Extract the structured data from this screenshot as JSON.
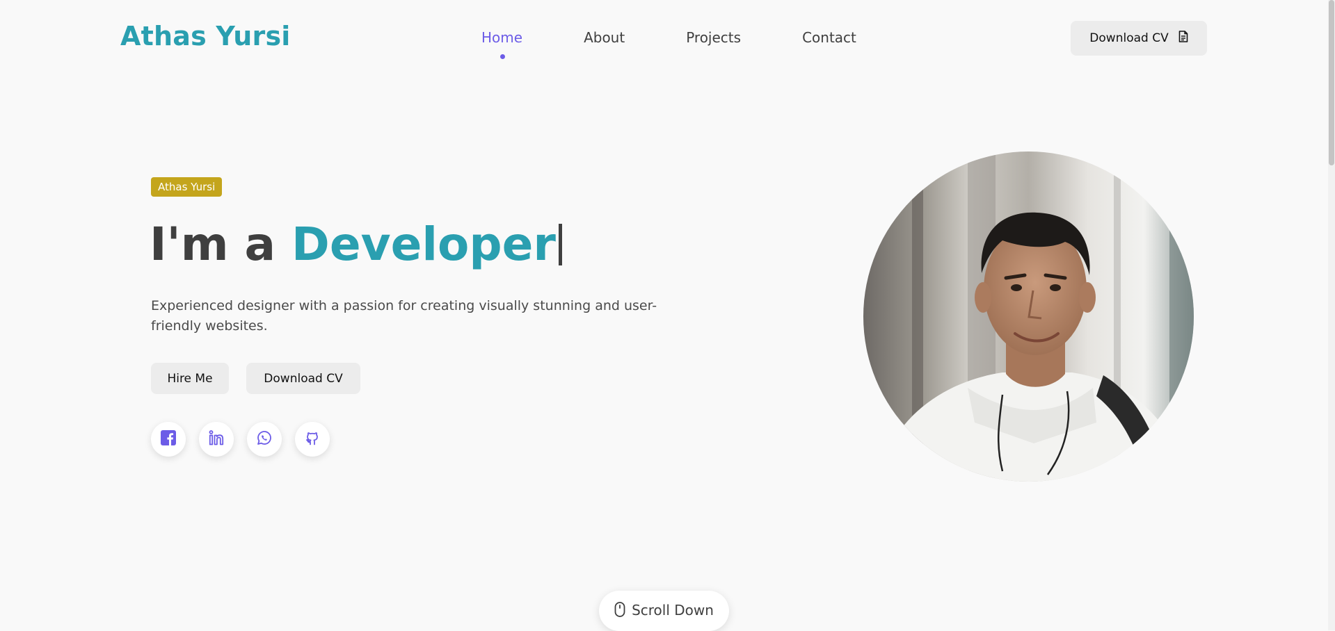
{
  "header": {
    "logo": "Athas Yursi",
    "nav": [
      {
        "label": "Home",
        "active": true
      },
      {
        "label": "About",
        "active": false
      },
      {
        "label": "Projects",
        "active": false
      },
      {
        "label": "Contact",
        "active": false
      }
    ],
    "download_cv_label": "Download CV",
    "download_icon": "file-text-icon"
  },
  "hero": {
    "badge": "Athas Yursi",
    "headline_prefix": "I'm a ",
    "headline_role": "Developer",
    "description": "Experienced designer with a passion for creating visually stunning and user-friendly websites.",
    "hire_label": "Hire Me",
    "download_cv_label": "Download CV",
    "socials": [
      {
        "name": "facebook-icon"
      },
      {
        "name": "linkedin-icon"
      },
      {
        "name": "whatsapp-icon"
      },
      {
        "name": "github-icon"
      }
    ]
  },
  "scroll_down": {
    "label": "Scroll Down",
    "icon": "mouse-icon"
  },
  "colors": {
    "accent_teal": "#2a9fb0",
    "accent_purple": "#6c5ce7",
    "badge_gold": "#c4a51c",
    "background": "#f9f9f9"
  }
}
